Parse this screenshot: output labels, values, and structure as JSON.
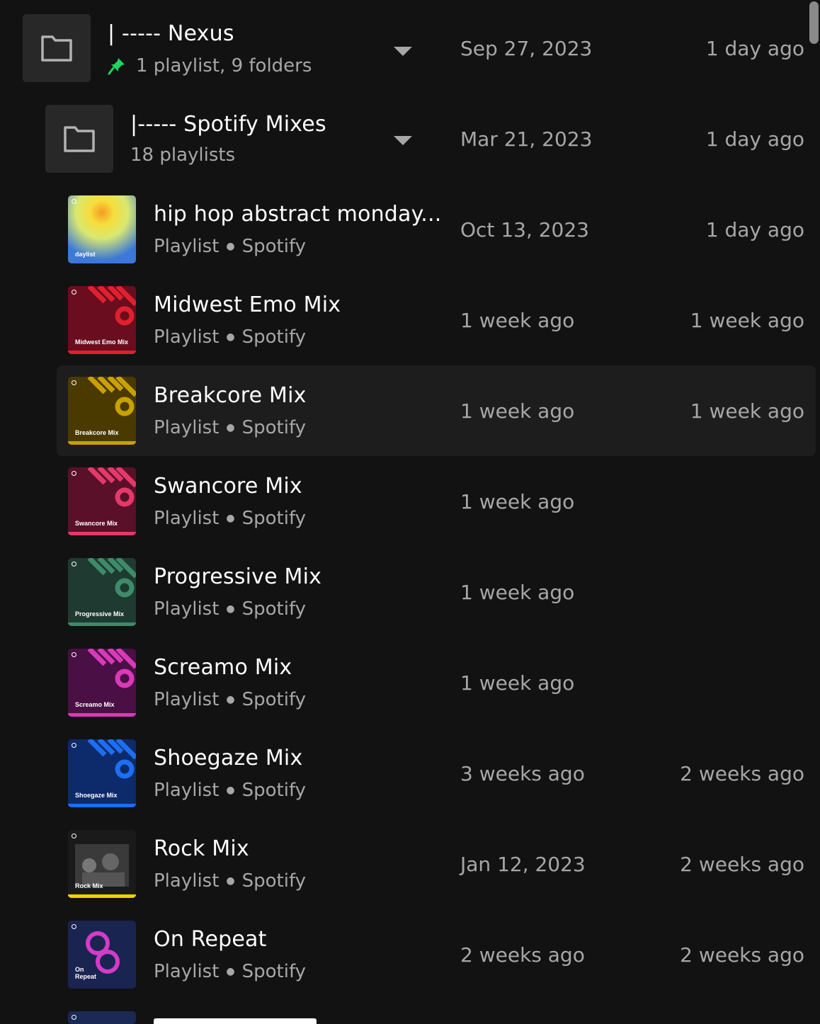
{
  "folders": [
    {
      "title": "| ----- Nexus",
      "subtitle": "1 playlist, 9 folders",
      "pinned": true,
      "date_added": "Sep 27, 2023",
      "last_played": "1 day ago",
      "icon": "folder-icon"
    },
    {
      "title": "|----- Spotify Mixes",
      "subtitle": "18 playlists",
      "pinned": false,
      "date_added": "Mar 21, 2023",
      "last_played": "1 day ago",
      "icon": "folder-icon"
    }
  ],
  "playlists": [
    {
      "title": "hip hop abstract monday...",
      "type": "Playlist",
      "owner": "Spotify",
      "date_added": "Oct 13, 2023",
      "last_played": "1 day ago",
      "cover_label": "daylist",
      "accent": "#f5d34a"
    },
    {
      "title": "Midwest Emo Mix",
      "type": "Playlist",
      "owner": "Spotify",
      "date_added": "1 week ago",
      "last_played": "1 week ago",
      "cover_label": "Midwest Emo Mix",
      "accent": "#e0202e"
    },
    {
      "title": "Breakcore Mix",
      "type": "Playlist",
      "owner": "Spotify",
      "date_added": "1 week ago",
      "last_played": "1 week ago",
      "cover_label": "Breakcore Mix",
      "accent": "#c9a100"
    },
    {
      "title": "Swancore Mix",
      "type": "Playlist",
      "owner": "Spotify",
      "date_added": "1 week ago",
      "last_played": "",
      "cover_label": "Swancore Mix",
      "accent": "#e33a6a"
    },
    {
      "title": "Progressive Mix",
      "type": "Playlist",
      "owner": "Spotify",
      "date_added": "1 week ago",
      "last_played": "",
      "cover_label": "Progressive Mix",
      "accent": "#3d8b6a"
    },
    {
      "title": "Screamo Mix",
      "type": "Playlist",
      "owner": "Spotify",
      "date_added": "1 week ago",
      "last_played": "",
      "cover_label": "Screamo Mix",
      "accent": "#d83ab8"
    },
    {
      "title": "Shoegaze Mix",
      "type": "Playlist",
      "owner": "Spotify",
      "date_added": "3 weeks ago",
      "last_played": "2 weeks ago",
      "cover_label": "Shoegaze Mix",
      "accent": "#1e6ff0"
    },
    {
      "title": "Rock Mix",
      "type": "Playlist",
      "owner": "Spotify",
      "date_added": "Jan 12, 2023",
      "last_played": "2 weeks ago",
      "cover_label": "Rock Mix",
      "accent": "#f0d000"
    },
    {
      "title": "On Repeat",
      "type": "Playlist",
      "owner": "Spotify",
      "date_added": "2 weeks ago",
      "last_played": "2 weeks ago",
      "cover_label": "On Repeat",
      "accent": "#d23cc8"
    }
  ],
  "highlighted_row": "Breakcore Mix",
  "colors": {
    "background": "#121212",
    "row_highlight": "#1d1d1d",
    "text_primary": "#ffffff",
    "text_secondary": "#a7a7a7",
    "pin_green": "#1ed760"
  }
}
